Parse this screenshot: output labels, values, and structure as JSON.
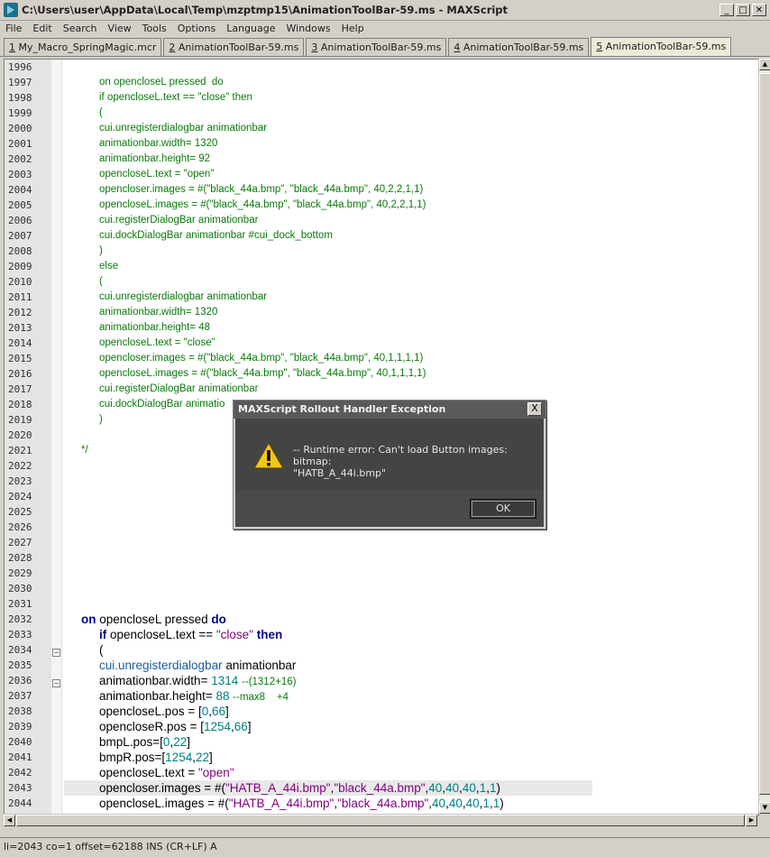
{
  "window": {
    "title": "C:\\Users\\user\\AppData\\Local\\Temp\\mzptmp15\\AnimationToolBar-59.ms - MAXScript",
    "minimize": "_",
    "maximize": "□",
    "close": "✕"
  },
  "menu": [
    "File",
    "Edit",
    "Search",
    "View",
    "Tools",
    "Options",
    "Language",
    "Windows",
    "Help"
  ],
  "tabs": [
    {
      "num": "1",
      "name": "My_Macro_SpringMagic.mcr"
    },
    {
      "num": "2",
      "name": "AnimationToolBar-59.ms"
    },
    {
      "num": "3",
      "name": "AnimationToolBar-59.ms"
    },
    {
      "num": "4",
      "name": "AnimationToolBar-59.ms"
    },
    {
      "num": "5",
      "name": "AnimationToolBar-59.ms"
    }
  ],
  "code_lines": [
    {
      "n": "1996",
      "c": ""
    },
    {
      "n": "1997",
      "c": "on opencloseL pressed  do"
    },
    {
      "n": "1998",
      "c": "if opencloseL.text == \"close\" then"
    },
    {
      "n": "1999",
      "c": "("
    },
    {
      "n": "2000",
      "c": "cui.unregisterdialogbar animationbar"
    },
    {
      "n": "2001",
      "c": "animationbar.width= 1320"
    },
    {
      "n": "2002",
      "c": "animationbar.height= 92"
    },
    {
      "n": "2003",
      "c": "opencloseL.text = \"open\""
    },
    {
      "n": "2004",
      "c": "opencloser.images = #(\"black_44a.bmp\", \"black_44a.bmp\", 40,2,2,1,1)"
    },
    {
      "n": "2005",
      "c": "opencloseL.images = #(\"black_44a.bmp\", \"black_44a.bmp\", 40,2,2,1,1)"
    },
    {
      "n": "2006",
      "c": "cui.registerDialogBar animationbar"
    },
    {
      "n": "2007",
      "c": "cui.dockDialogBar animationbar #cui_dock_bottom"
    },
    {
      "n": "2008",
      "c": ")"
    },
    {
      "n": "2009",
      "c": "else"
    },
    {
      "n": "2010",
      "c": "("
    },
    {
      "n": "2011",
      "c": "cui.unregisterdialogbar animationbar"
    },
    {
      "n": "2012",
      "c": "animationbar.width= 1320"
    },
    {
      "n": "2013",
      "c": "animationbar.height= 48"
    },
    {
      "n": "2014",
      "c": "opencloseL.text = \"close\""
    },
    {
      "n": "2015",
      "c": "opencloser.images = #(\"black_44a.bmp\", \"black_44a.bmp\", 40,1,1,1,1)"
    },
    {
      "n": "2016",
      "c": "opencloseL.images = #(\"black_44a.bmp\", \"black_44a.bmp\", 40,1,1,1,1)"
    },
    {
      "n": "2017",
      "c": "cui.registerDialogBar animationbar"
    },
    {
      "n": "2018",
      "c": "cui.dockDialogBar animatio"
    },
    {
      "n": "2019",
      "c": ")"
    },
    {
      "n": "2020",
      "c": ""
    },
    {
      "n": "2021",
      "c": "*/"
    },
    {
      "n": "2022",
      "c": ""
    },
    {
      "n": "2023",
      "c": ""
    },
    {
      "n": "2024",
      "c": ""
    },
    {
      "n": "2025",
      "c": ""
    },
    {
      "n": "2026",
      "c": ""
    },
    {
      "n": "2027",
      "c": ""
    },
    {
      "n": "2028",
      "c": ""
    },
    {
      "n": "2029",
      "c": ""
    },
    {
      "n": "2030",
      "c": ""
    },
    {
      "n": "2031",
      "c": ""
    },
    {
      "n": "2032",
      "c": ""
    },
    {
      "n": "2033",
      "c": ""
    },
    {
      "n": "2034",
      "c": ""
    },
    {
      "n": "2035",
      "c": ""
    },
    {
      "n": "2036",
      "c": ""
    },
    {
      "n": "2037",
      "c": ""
    },
    {
      "n": "2038",
      "c": ""
    },
    {
      "n": "2039",
      "c": ""
    },
    {
      "n": "2040",
      "c": ""
    },
    {
      "n": "2041",
      "c": ""
    },
    {
      "n": "2042",
      "c": ""
    },
    {
      "n": "2043",
      "c": ""
    },
    {
      "n": "2044",
      "c": ""
    }
  ],
  "rich_lines": {
    "l2032": {
      "kw1": "on",
      "t1": "opencloseL pressed",
      "kw2": "do"
    },
    "l2033": {
      "kw1": "if",
      "t1": "opencloseL.text ==",
      "s1": "\"close\"",
      "kw2": "then"
    },
    "l2034": {
      "t1": "("
    },
    "l2035": {
      "fn": "cui.unregisterdialogbar",
      "t1": "animationbar"
    },
    "l2036": {
      "t1": "animationbar.width=",
      "n1": "1314",
      "c1": "--(1312+16)"
    },
    "l2037": {
      "t1": "animationbar.height=",
      "n1": "88",
      "c1": "--max8    +4"
    },
    "l2038": {
      "t1": "opencloseL.pos = [",
      "n1": "0",
      "t2": ",",
      "n2": "66",
      "t3": "]"
    },
    "l2039": {
      "t1": "opencloseR.pos = [",
      "n1": "1254",
      "t2": ",",
      "n2": "66",
      "t3": "]"
    },
    "l2040": {
      "t1": "bmpL.pos=[",
      "n1": "0",
      "t2": ",",
      "n2": "22",
      "t3": "]"
    },
    "l2041": {
      "t1": "bmpR.pos=[",
      "n1": "1254",
      "t2": ",",
      "n2": "22",
      "t3": "]"
    },
    "l2042": {
      "t1": "opencloseL.text =",
      "s1": "\"open\""
    },
    "l2043": {
      "t1": "opencloser.images = #(",
      "s1": "\"HATB_A_44i.bmp\"",
      "t2": ",",
      "s2": "\"black_44a.bmp\"",
      "t3": ",",
      "n1": "40",
      "t4": ",",
      "n2": "40",
      "t5": ",",
      "n3": "40",
      "t6": ",",
      "n4": "1",
      "t7": ",",
      "n5": "1",
      "t8": ")"
    },
    "l2044": {
      "t1": "opencloseL.images = #(",
      "s1": "\"HATB_A_44i.bmp\"",
      "t2": ",",
      "s2": "\"black_44a.bmp\"",
      "t3": ",",
      "n1": "40",
      "t4": ",",
      "n2": "40",
      "t5": ",",
      "n3": "40",
      "t6": ",",
      "n4": "1",
      "t7": ",",
      "n5": "1",
      "t8": ")"
    }
  },
  "dialog": {
    "title": "MAXScript Rollout Handler Exception",
    "close": "X",
    "message_line1": "-- Runtime error: Can't load Button images: bitmap:",
    "message_line2": "\"HATB_A_44i.bmp\"",
    "ok": "OK"
  },
  "status": "li=2043 co=1 offset=62188 INS (CR+LF) A",
  "colors": {
    "keyword": "#00008b",
    "string": "#7f007f",
    "number": "#008080",
    "comment": "#0a7a0a",
    "dialog_body": "#444444"
  }
}
